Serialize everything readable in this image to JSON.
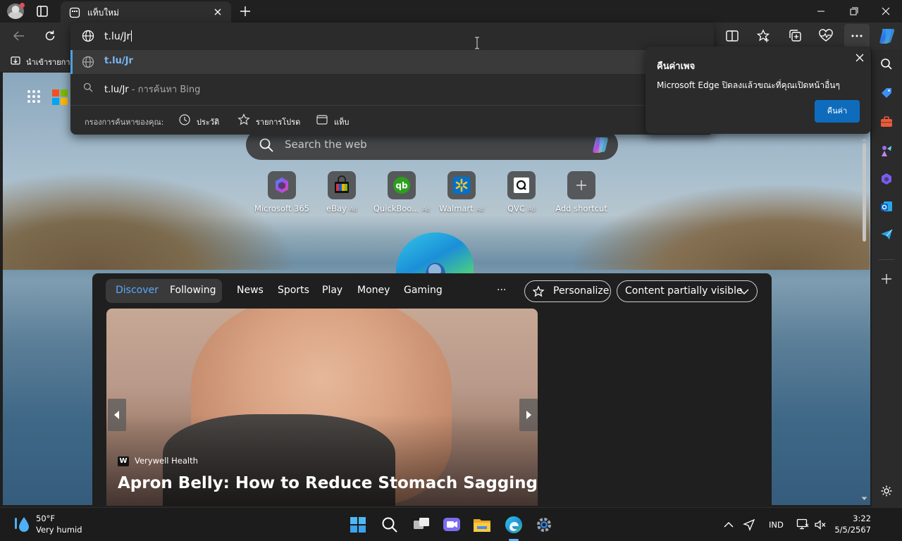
{
  "browser": {
    "tab_title": "แท็บใหม่",
    "address_value": "t.lu/Jr"
  },
  "suggestions": {
    "items": [
      {
        "text": "t.lu/Jr",
        "suffix": ""
      },
      {
        "text": "t.lu/Jr",
        "suffix": " - การค้นหา Bing"
      }
    ],
    "filter_label": "กรองการค้นหาของคุณ:",
    "filters": [
      "ประวัติ",
      "รายการโปรด",
      "แท็บ"
    ]
  },
  "bookmarks": {
    "first_label": "นำเข้ารายการ"
  },
  "popup": {
    "title": "คืนค่าเพจ",
    "message": "Microsoft Edge ปิดลงแล้วขณะที่คุณเปิดหน้าอื่นๆ",
    "button": "คืนค่า"
  },
  "newtab": {
    "search_placeholder": "Search the web",
    "ad_badge": "Ad",
    "shortcuts": [
      {
        "label": "Microsoft 365",
        "ad": false
      },
      {
        "label": "eBay",
        "ad": true
      },
      {
        "label": "QuickBoo...",
        "ad": true
      },
      {
        "label": "Walmart",
        "ad": true
      },
      {
        "label": "QVC",
        "ad": true
      },
      {
        "label": "Add shortcut",
        "ad": false
      }
    ]
  },
  "feed": {
    "pivots": [
      "Discover",
      "Following"
    ],
    "nav": [
      "News",
      "Sports",
      "Play",
      "Money",
      "Gaming"
    ],
    "more": "···",
    "personalize": "Personalize",
    "content_filter": "Content partially visible",
    "card": {
      "source": "Verywell Health",
      "source_initial": "W",
      "headline": "Apron Belly: How to Reduce Stomach Sagging"
    }
  },
  "taskbar": {
    "weather_temp": "50°F",
    "weather_desc": "Very humid",
    "language": "IND",
    "time": "3:22",
    "date": "5/5/2567"
  },
  "colors": {
    "accent": "#0f6cbd",
    "highlight": "#4f9fe0"
  }
}
